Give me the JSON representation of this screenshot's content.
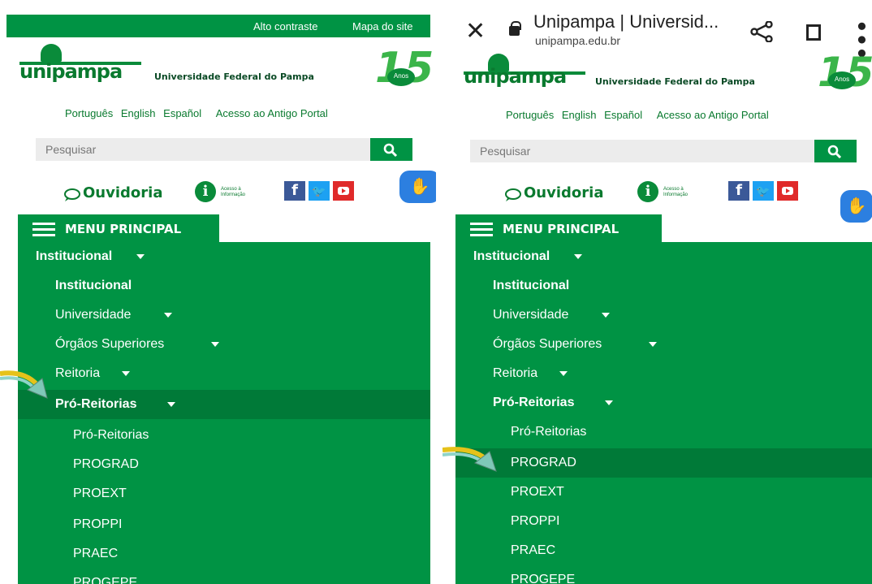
{
  "left": {
    "topbar": {
      "contrast": "Alto contraste",
      "sitemap": "Mapa do site"
    },
    "logo": {
      "word": "unipampa",
      "subtitle": "Universidade Federal do Pampa",
      "anniversary": "15",
      "anniversary_label": "Anos"
    },
    "languages": [
      "Português",
      "English",
      "Español",
      "Acesso ao Antigo Portal"
    ],
    "search": {
      "placeholder": "Pesquisar"
    },
    "ouvidoria": "Ouvidoria",
    "info_label_1": "Acesso à",
    "info_label_2": "Informação",
    "menu": {
      "title": "MENU PRINCIPAL",
      "items": [
        {
          "label": "Institucional"
        },
        {
          "label": "Institucional"
        },
        {
          "label": "Universidade"
        },
        {
          "label": "Órgãos Superiores"
        },
        {
          "label": "Reitoria"
        },
        {
          "label": "Pró-Reitorias"
        },
        {
          "label": "Pró-Reitorias"
        },
        {
          "label": "PROGRAD"
        },
        {
          "label": "PROEXT"
        },
        {
          "label": "PROPPI"
        },
        {
          "label": "PRAEC"
        },
        {
          "label": "PROGEPE"
        }
      ]
    }
  },
  "right": {
    "browser": {
      "title": "Unipampa | Universid...",
      "url": "unipampa.edu.br"
    },
    "logo": {
      "word": "unipampa",
      "subtitle": "Universidade Federal do Pampa",
      "anniversary": "15",
      "anniversary_label": "Anos"
    },
    "languages": [
      "Português",
      "English",
      "Español",
      "Acesso ao Antigo Portal"
    ],
    "search": {
      "placeholder": "Pesquisar"
    },
    "ouvidoria": "Ouvidoria",
    "info_label_1": "Acesso à",
    "info_label_2": "Informação",
    "menu": {
      "title": "MENU PRINCIPAL",
      "items": [
        {
          "label": "Institucional"
        },
        {
          "label": "Institucional"
        },
        {
          "label": "Universidade"
        },
        {
          "label": "Órgãos Superiores"
        },
        {
          "label": "Reitoria"
        },
        {
          "label": "Pró-Reitorias"
        },
        {
          "label": "Pró-Reitorias"
        },
        {
          "label": "PROGRAD"
        },
        {
          "label": "PROEXT"
        },
        {
          "label": "PROPPI"
        },
        {
          "label": "PRAEC"
        },
        {
          "label": "PROGEPE"
        }
      ]
    }
  },
  "colors": {
    "brand_green": "#009344",
    "highlight_green": "#007a38",
    "logo_green": "#0a7a2f"
  },
  "icons": [
    "close-icon",
    "lock-icon",
    "share-icon",
    "bookmark-icon",
    "more-vert-icon",
    "search-icon",
    "chat-bubble-icon",
    "info-icon",
    "facebook-icon",
    "twitter-icon",
    "youtube-icon",
    "sign-language-icon",
    "hamburger-icon",
    "caret-down-icon",
    "pointer-arrow-icon"
  ]
}
